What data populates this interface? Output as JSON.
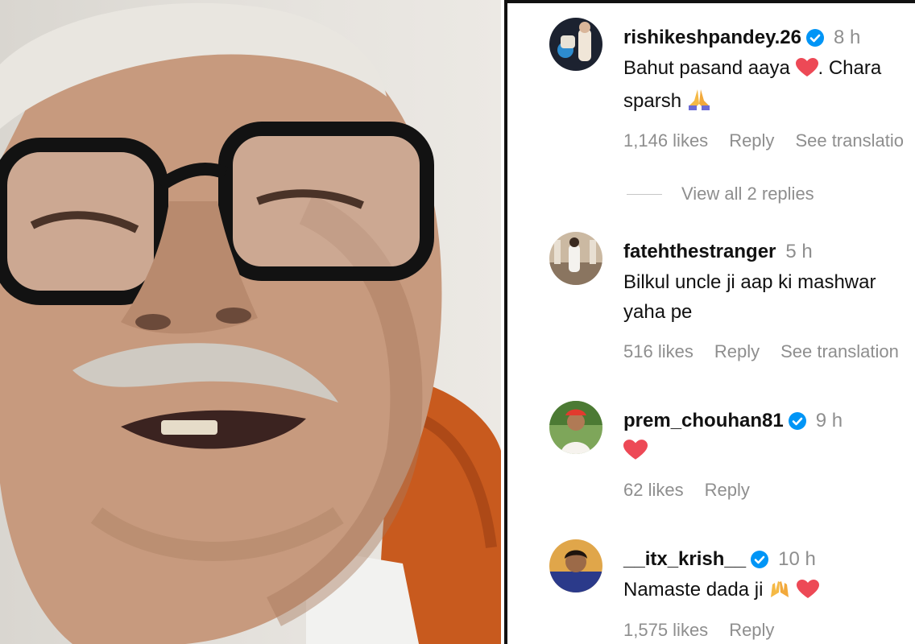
{
  "photo": {
    "description_icon": "video-frame-icon"
  },
  "comments": [
    {
      "username": "rishikeshpandey.26",
      "verified": true,
      "time": "8 h",
      "text_lines": [
        "Bahut pasand aaya",
        ". Chara",
        "sparsh"
      ],
      "likes": "1,146 likes",
      "reply": "Reply",
      "translation": "See translatio"
    },
    {
      "username": "fatehthestranger",
      "verified": false,
      "time": "5 h",
      "text_lines": [
        "Bilkul uncle ji aap ki mashwar",
        "yaha pe"
      ],
      "likes": "516 likes",
      "reply": "Reply",
      "translation": "See translation"
    },
    {
      "username": "prem_chouhan81",
      "verified": true,
      "time": "9 h",
      "text_lines": [
        ""
      ],
      "likes": "62 likes",
      "reply": "Reply"
    },
    {
      "username": "__itx_krish__",
      "verified": true,
      "time": "10 h",
      "text_lines": [
        "Namaste dada ji"
      ],
      "likes": "1,575 likes",
      "reply": "Reply"
    }
  ],
  "view_replies": "View all 2 replies",
  "colors": {
    "verified": "#0095f6",
    "heart": "#ed4956",
    "muted": "#8e8e8e",
    "text": "#111111"
  }
}
